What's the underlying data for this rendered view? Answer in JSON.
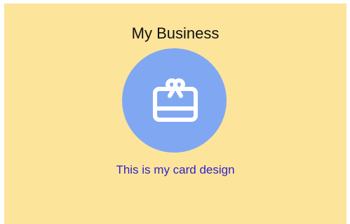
{
  "card": {
    "title": "My Business",
    "subtitle": "This is my card design",
    "icon": "gift-card-icon",
    "colors": {
      "background": "#fde49b",
      "icon_circle": "#80a8f2",
      "icon_stroke": "#ffffff",
      "subtitle": "#2f23c9"
    }
  }
}
